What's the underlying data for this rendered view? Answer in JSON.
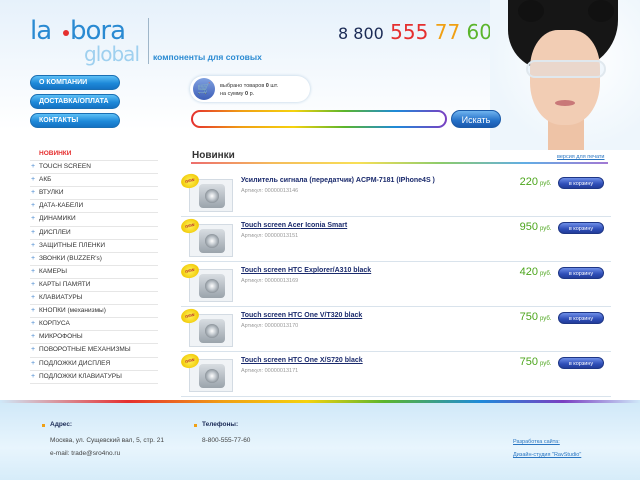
{
  "header": {
    "logo_la": "la",
    "logo_bora": "bora",
    "logo_global": "global",
    "tagline": "компоненты для сотовых",
    "phone": {
      "prefix": "8 800",
      "part1": "555",
      "part2": "77",
      "part3": "60"
    }
  },
  "nav": {
    "about": "О КОМПАНИИ",
    "delivery": "ДОСТАВКА/ОПЛАТА",
    "contacts": "КОНТАКТЫ"
  },
  "cart": {
    "line1_prefix": "выбрано товаров",
    "count": "0",
    "line1_suffix": "шт.",
    "line2_prefix": "на сумму",
    "sum": "0",
    "line2_suffix": "р."
  },
  "search": {
    "value": "",
    "button": "Искать"
  },
  "categories": [
    "НОВИНКИ",
    "TOUCH SCREEN",
    "АКБ",
    "ВТУЛКИ",
    "ДАТА-КАБЕЛИ",
    "ДИНАМИКИ",
    "ДИСПЛЕИ",
    "ЗАЩИТНЫЕ ПЛЕНКИ",
    "ЗВОНКИ (BUZZER's)",
    "КАМЕРЫ",
    "КАРТЫ ПАМЯТИ",
    "КЛАВИАТУРЫ",
    "КНОПКИ (механизмы)",
    "КОРПУСА",
    "МИКРОФОНЫ",
    "ПОВОРОТНЫЕ МЕХАНИЗМЫ",
    "ПОДЛОЖКИ ДИСПЛЕЯ",
    "ПОДЛОЖКИ КЛАВИАТУРЫ"
  ],
  "section": {
    "title": "Новинки",
    "print_link": "версия для печати"
  },
  "badge_new": "new",
  "sku_label": "Артикул:",
  "currency": "руб.",
  "buy_label": "в корзину",
  "products": [
    {
      "name": "Усилитель сигнала (передатчик) ACPM-7181 (IPhone4S )",
      "sku": "00000013146",
      "price": "220"
    },
    {
      "name": "Touch screen Acer Iconia Smart",
      "sku": "00000013151",
      "price": "950"
    },
    {
      "name": "Touch screen HTC Explorer/A310 black",
      "sku": "00000013169",
      "price": "420"
    },
    {
      "name": "Touch screen HTC One V/T320 black",
      "sku": "00000013170",
      "price": "750"
    },
    {
      "name": "Touch screen HTC One X/S720 black",
      "sku": "00000013171",
      "price": "750"
    }
  ],
  "footer": {
    "address_label": "Адрес:",
    "address": "Москва, ул. Сущевский вал, 5, стр. 21",
    "email": "e-mail: trade@sro4no.ru",
    "phones_label": "Телефоны:",
    "phone": "8-800-555-77-60",
    "dev_link": "Разработка сайта:",
    "design_link": "Дизайн-студия \"RavStudio\""
  },
  "colors": {
    "accent": "#1e8ad9",
    "price": "#4ca51c",
    "brand_red": "#e52f2f"
  }
}
